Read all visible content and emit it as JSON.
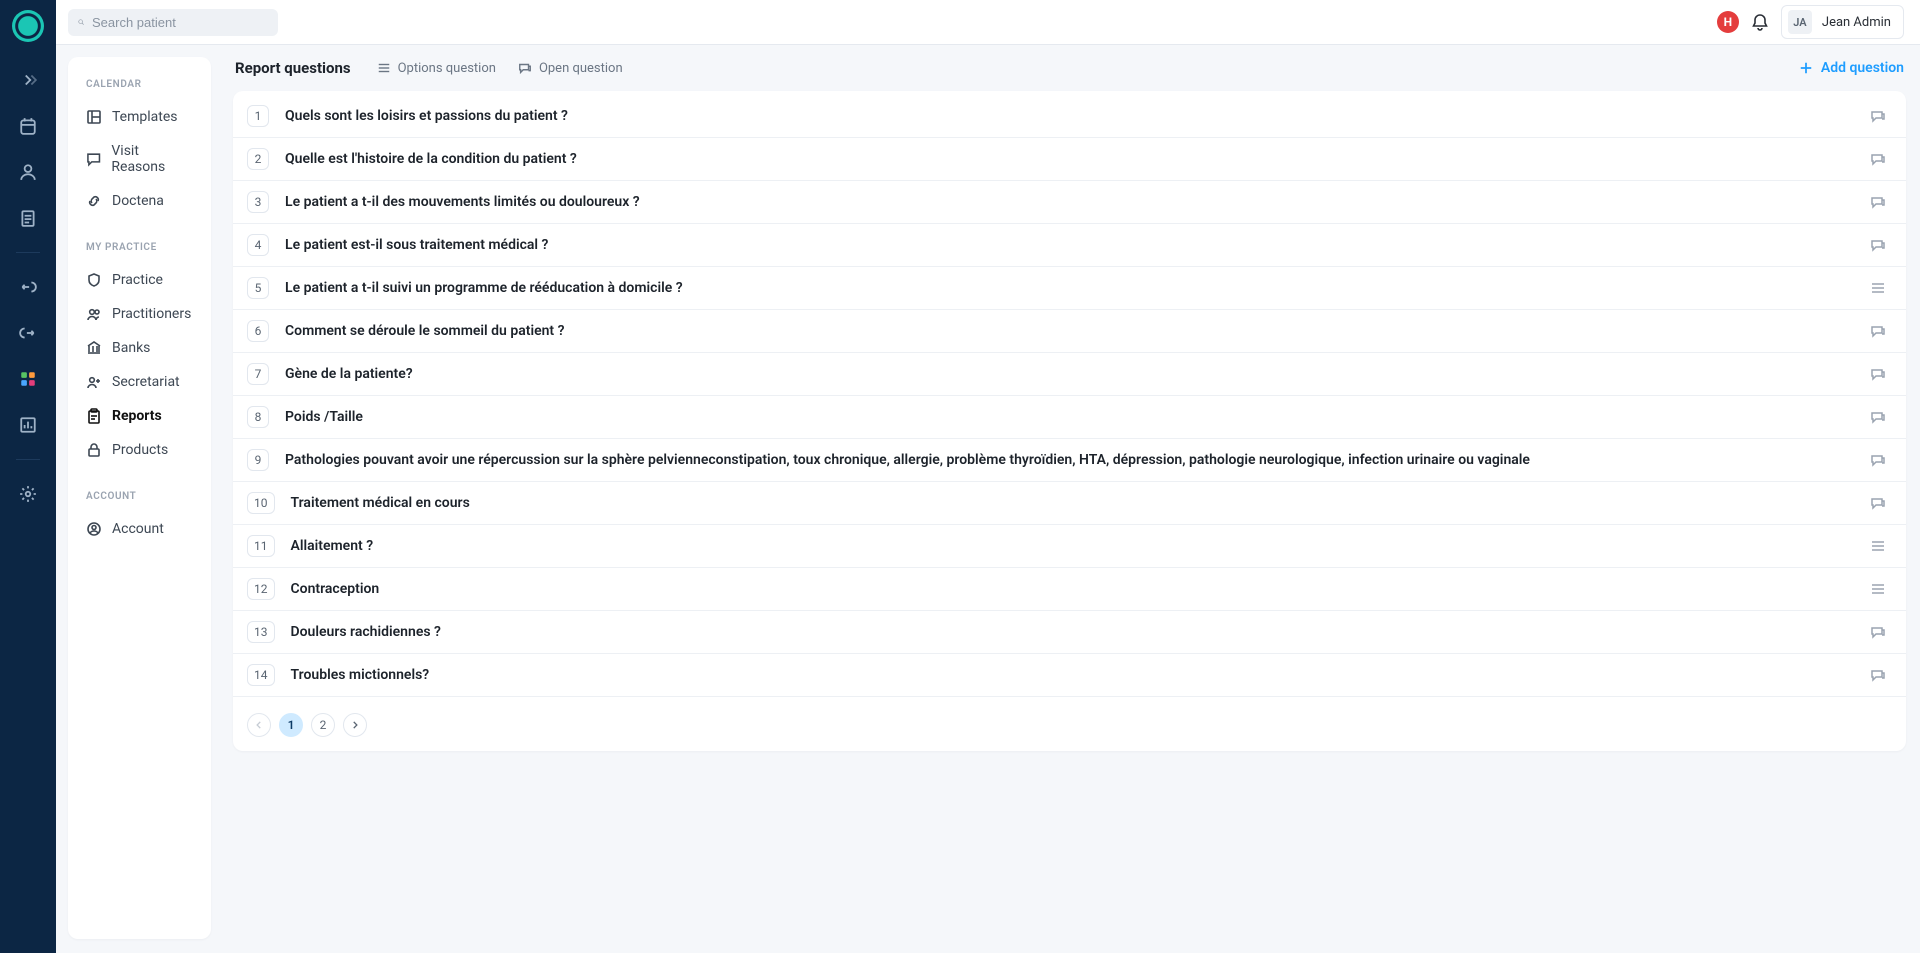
{
  "topbar": {
    "search_placeholder": "Search patient",
    "h_badge": "H",
    "user_initials": "JA",
    "user_name": "Jean Admin"
  },
  "sidebar": {
    "groups": [
      {
        "heading": "CALENDAR",
        "items": [
          {
            "label": "Templates",
            "icon": "template"
          },
          {
            "label": "Visit Reasons",
            "icon": "comment"
          },
          {
            "label": "Doctena",
            "icon": "link"
          }
        ]
      },
      {
        "heading": "MY PRACTICE",
        "items": [
          {
            "label": "Practice",
            "icon": "shield"
          },
          {
            "label": "Practitioners",
            "icon": "users"
          },
          {
            "label": "Banks",
            "icon": "bank"
          },
          {
            "label": "Secretariat",
            "icon": "user-plus"
          },
          {
            "label": "Reports",
            "icon": "clipboard",
            "active": true
          },
          {
            "label": "Products",
            "icon": "lock"
          }
        ]
      },
      {
        "heading": "ACCOUNT",
        "items": [
          {
            "label": "Account",
            "icon": "user-circle"
          }
        ]
      }
    ]
  },
  "content": {
    "title": "Report questions",
    "legend_options": "Options question",
    "legend_open": "Open question",
    "add_question": "Add question",
    "questions": [
      {
        "n": "1",
        "text": "Quels sont les loisirs et passions du patient ?",
        "type": "open"
      },
      {
        "n": "2",
        "text": "Quelle est l'histoire de la condition du patient ?",
        "type": "open"
      },
      {
        "n": "3",
        "text": "Le patient a t-il des mouvements limités ou douloureux ?",
        "type": "open"
      },
      {
        "n": "4",
        "text": "Le patient est-il sous traitement médical ?",
        "type": "open"
      },
      {
        "n": "5",
        "text": "Le patient a t-il suivi un programme de rééducation à domicile ?",
        "type": "options"
      },
      {
        "n": "6",
        "text": "Comment se déroule le sommeil du patient ?",
        "type": "open"
      },
      {
        "n": "7",
        "text": "Gène de la patiente?",
        "type": "open"
      },
      {
        "n": "8",
        "text": "Poids /Taille",
        "type": "open"
      },
      {
        "n": "9",
        "text": "Pathologies pouvant avoir une répercussion sur la sphère pelvienneconstipation, toux chronique, allergie, problème thyroïdien, HTA, dépression, pathologie neurologique, infection urinaire ou vaginale",
        "type": "open"
      },
      {
        "n": "10",
        "text": "Traitement médical en cours",
        "type": "open"
      },
      {
        "n": "11",
        "text": "Allaitement ?",
        "type": "options"
      },
      {
        "n": "12",
        "text": "Contraception",
        "type": "options"
      },
      {
        "n": "13",
        "text": "Douleurs rachidiennes ?",
        "type": "open"
      },
      {
        "n": "14",
        "text": "Troubles mictionnels?",
        "type": "open"
      }
    ],
    "pagination": {
      "pages": [
        "1",
        "2"
      ],
      "current": "1"
    }
  }
}
